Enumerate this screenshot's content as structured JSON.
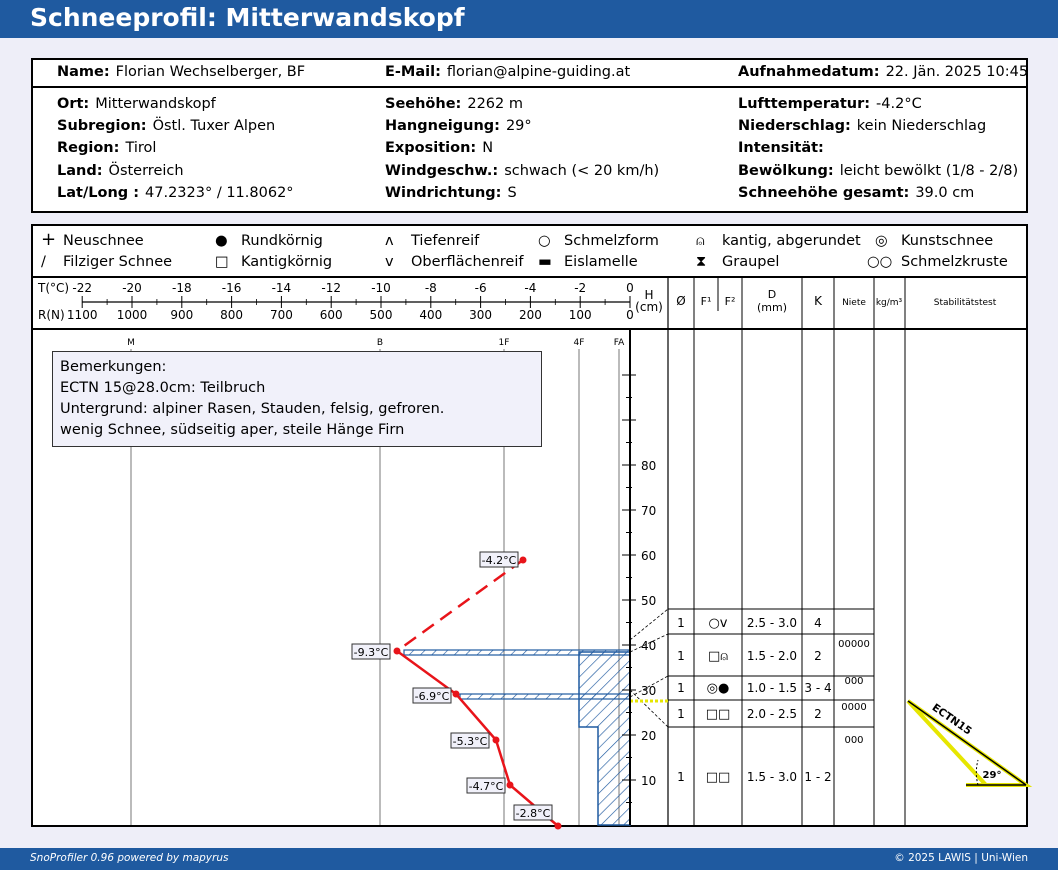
{
  "title": "Schneeprofil: Mitterwandskopf",
  "header": {
    "name_label": "Name:",
    "name": "Florian Wechselberger, BF",
    "email_label": "E-Mail:",
    "email": "florian@alpine-guiding.at",
    "date_label": "Aufnahmedatum:",
    "date": "22. Jän. 2025 10:45"
  },
  "meta": {
    "col1": [
      {
        "k": "Ort:",
        "v": "Mitterwandskopf"
      },
      {
        "k": "Subregion:",
        "v": "Östl. Tuxer Alpen"
      },
      {
        "k": "Region:",
        "v": "Tirol"
      },
      {
        "k": "Land:",
        "v": "Österreich"
      },
      {
        "k": "Lat/Long :",
        "v": "47.2323° / 11.8062°"
      }
    ],
    "col2": [
      {
        "k": "Seehöhe:",
        "v": "2262 m"
      },
      {
        "k": "Hangneigung:",
        "v": "29°"
      },
      {
        "k": "Exposition:",
        "v": "N"
      },
      {
        "k": "Windgeschw.:",
        "v": "schwach (< 20 km/h)"
      },
      {
        "k": "Windrichtung:",
        "v": "S"
      }
    ],
    "col3": [
      {
        "k": "Lufttemperatur:",
        "v": "-4.2°C"
      },
      {
        "k": "Niederschlag:",
        "v": "kein Niederschlag"
      },
      {
        "k": "Intensität:",
        "v": ""
      },
      {
        "k": "Bewölkung:",
        "v": "leicht bewölkt (1/8 - 2/8)"
      },
      {
        "k": "Schneehöhe gesamt:",
        "v": "39.0 cm"
      }
    ]
  },
  "legend": [
    {
      "icon": "plus-icon",
      "glyph": "+",
      "label": "Neuschnee"
    },
    {
      "icon": "slash-icon",
      "glyph": "/",
      "label": "Filziger Schnee"
    },
    {
      "icon": "filled-circle-icon",
      "glyph": "●",
      "label": "Rundkörnig"
    },
    {
      "icon": "square-icon",
      "glyph": "□",
      "label": "Kantigkörnig"
    },
    {
      "icon": "caret-icon",
      "glyph": "ʌ",
      "label": "Tiefenreif"
    },
    {
      "icon": "v-icon",
      "glyph": "v",
      "label": "Oberflächenreif"
    },
    {
      "icon": "circle-icon",
      "glyph": "○",
      "label": "Schmelzform"
    },
    {
      "icon": "bar-icon",
      "glyph": "▬",
      "label": "Eislamelle"
    },
    {
      "icon": "lock-icon",
      "glyph": "⍝",
      "label": "kantig, abgerundet"
    },
    {
      "icon": "hourglass-icon",
      "glyph": "⧗",
      "label": "Graupel"
    },
    {
      "icon": "double-circle-icon",
      "glyph": "◎",
      "label": "Kunstschnee"
    },
    {
      "icon": "melt-crust-icon",
      "glyph": "∞",
      "label": "Schmelzkruste"
    }
  ],
  "axes": {
    "temp_label": "T(°C)",
    "temp_ticks": [
      "-22",
      "-20",
      "-18",
      "-16",
      "-14",
      "-12",
      "-10",
      "-8",
      "-6",
      "-4",
      "-2",
      "0"
    ],
    "res_label": "R(N)",
    "res_ticks": [
      "1100",
      "1000",
      "900",
      "800",
      "700",
      "600",
      "500",
      "400",
      "300",
      "200",
      "100",
      "0"
    ],
    "hardness_ticks": [
      "M",
      "B",
      "1F",
      "4F",
      "FA"
    ],
    "height_label_1": "H",
    "height_label_2": "(cm)",
    "height_ticks": [
      "10",
      "20",
      "30",
      "40",
      "50",
      "60",
      "70",
      "80"
    ]
  },
  "table_headers": {
    "num": "Ø",
    "f1": "F¹",
    "f2": "F²",
    "d1": "D",
    "d2": "(mm)",
    "k": "K",
    "niete": "Niete",
    "density": "kg/m³",
    "stab": "Stabilitätstest"
  },
  "layers": [
    {
      "nr": "1",
      "grain": "○v",
      "d": "2.5 - 3.0",
      "k": "4",
      "niete": ""
    },
    {
      "nr": "1",
      "grain": "□⍝",
      "d": "1.5 - 2.0",
      "k": "2",
      "niete": "00000"
    },
    {
      "nr": "1",
      "grain": "◎●",
      "d": "1.0 - 1.5",
      "k": "3 - 4",
      "niete": "000"
    },
    {
      "nr": "1",
      "grain": "□□",
      "d": "2.0 - 2.5",
      "k": "2",
      "niete": "0000"
    },
    {
      "nr": "1",
      "grain": "□□",
      "d": "1.5 - 3.0",
      "k": "1 - 2",
      "niete": "000"
    }
  ],
  "temperature_labels": [
    "-4.2°C",
    "-9.3°C",
    "-6.9°C",
    "-5.3°C",
    "-4.7°C",
    "-2.8°C"
  ],
  "remarks": {
    "title": "Bemerkungen:",
    "lines": [
      "ECTN 15@28.0cm: Teilbruch",
      "Untergrund: alpiner Rasen, Stauden, felsig, gefroren.",
      "wenig Schnee, südseitig aper, steile Hänge Firn"
    ]
  },
  "stability": {
    "test": "ECTN15",
    "angle": "29°"
  },
  "footer": {
    "left": "SnoProfiler 0.96 powered by mapyrus",
    "right": "© 2025 LAWIS | Uni-Wien"
  },
  "colors": {
    "brand": "#1f5aa0",
    "temperature": "#e8141a",
    "hardness": "#1f5aa0",
    "weak_layer": "#e6e600"
  }
}
